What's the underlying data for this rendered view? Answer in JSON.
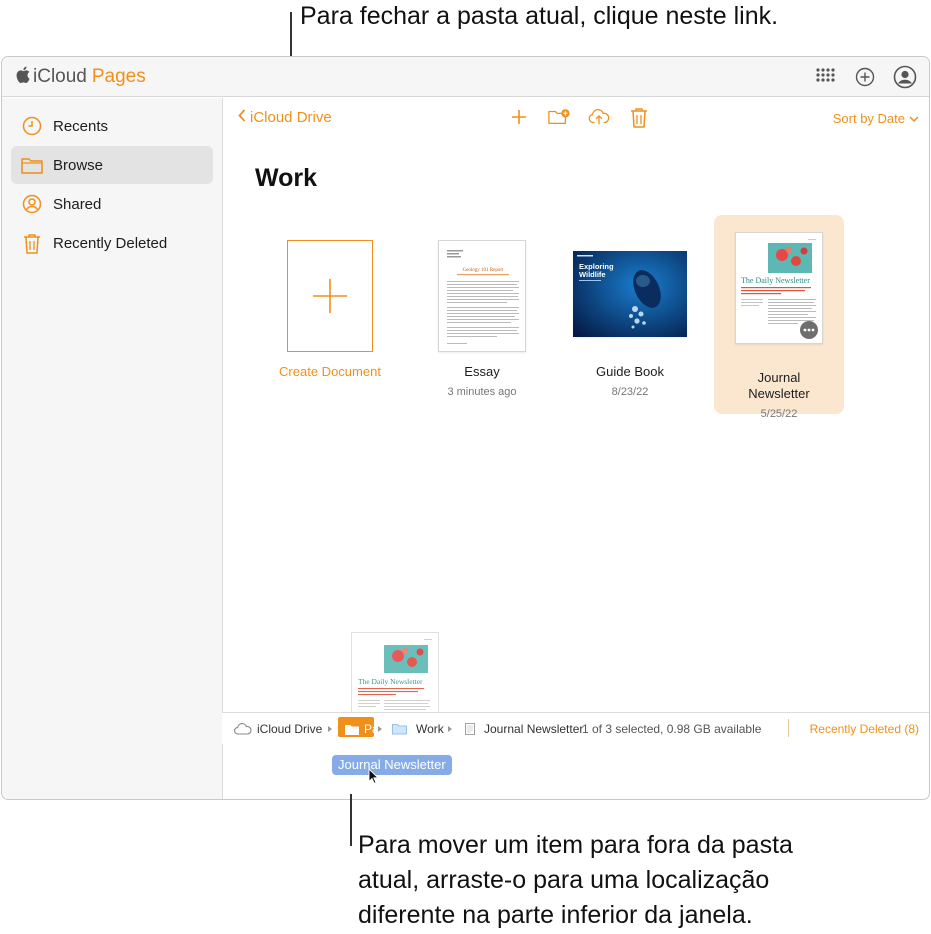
{
  "callouts": {
    "top": "Para fechar a pasta atual, clique neste link.",
    "bottom": "Para mover um item para fora da pasta\natual, arraste-o para uma localização\ndiferente na parte inferior da janela."
  },
  "app": {
    "brand": "iCloud",
    "name": "Pages",
    "accent": "#f0901a"
  },
  "sidebar": {
    "items": [
      {
        "label": "Recents",
        "icon": "clock-icon"
      },
      {
        "label": "Browse",
        "icon": "folder-icon",
        "active": true
      },
      {
        "label": "Shared",
        "icon": "person-icon"
      },
      {
        "label": "Recently Deleted",
        "icon": "trash-icon"
      }
    ]
  },
  "toolbar": {
    "back_label": "iCloud Drive",
    "sort_label": "Sort by Date"
  },
  "folder": {
    "title": "Work"
  },
  "documents": [
    {
      "name": "Create Document",
      "date": ""
    },
    {
      "name": "Essay",
      "date": "3 minutes ago"
    },
    {
      "name": "Guide Book",
      "date": "8/23/22"
    },
    {
      "name": "Journal\nNewsletter",
      "date": "5/25/22"
    }
  ],
  "thumbs": {
    "essay_title": "Geology 101 Report",
    "guide_title": "Exploring\nWildlife",
    "newsletter_title": "The Daily Newsletter"
  },
  "drag": {
    "label": "Journal Newsletter"
  },
  "pathbar": {
    "items": [
      "iCloud Drive",
      "Pa",
      "Work",
      "Journal Newsletter"
    ],
    "status": "1 of 3 selected, 0.98 GB available",
    "recently_deleted": "Recently Deleted (8)"
  }
}
